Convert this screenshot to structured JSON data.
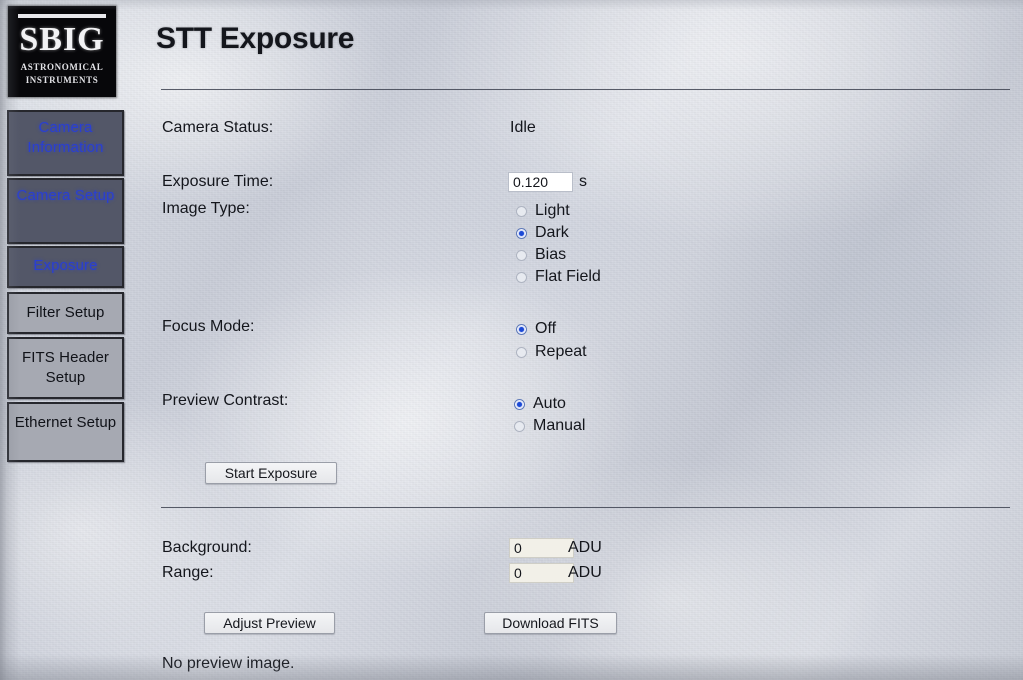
{
  "app": {
    "brand": {
      "name": "SBIG",
      "tagline_line1": "ASTRONOMICAL",
      "tagline_line2": "INSTRUMENTS"
    },
    "page_title": "STT Exposure"
  },
  "sidebar": {
    "items": [
      {
        "label": "Camera Information",
        "style": "link"
      },
      {
        "label": "Camera Setup",
        "style": "link"
      },
      {
        "label": "Exposure",
        "style": "link"
      },
      {
        "label": "Filter Setup",
        "style": "plain"
      },
      {
        "label": "FITS Header Setup",
        "style": "plain"
      },
      {
        "label": "Ethernet Setup",
        "style": "plain"
      }
    ]
  },
  "main": {
    "camera_status": {
      "label": "Camera Status:",
      "value": "Idle"
    },
    "exposure_time": {
      "label": "Exposure Time:",
      "value": "0.120",
      "unit": "s"
    },
    "image_type": {
      "label": "Image Type:",
      "options": [
        "Light",
        "Dark",
        "Bias",
        "Flat Field"
      ],
      "selected": "Dark"
    },
    "focus_mode": {
      "label": "Focus Mode:",
      "options": [
        "Off",
        "Repeat"
      ],
      "selected": "Off"
    },
    "preview_contrast": {
      "label": "Preview Contrast:",
      "options": [
        "Auto",
        "Manual"
      ],
      "selected": "Auto"
    },
    "start_exposure_button": "Start Exposure",
    "background": {
      "label": "Background:",
      "value": "0",
      "unit": "ADU"
    },
    "range": {
      "label": "Range:",
      "value": "0",
      "unit": "ADU"
    },
    "adjust_preview_button": "Adjust Preview",
    "download_fits_button": "Download FITS",
    "preview_status": "No preview image."
  },
  "colors": {
    "link_text": "#2a3fd0",
    "radio_selected": "#1b49d6",
    "nav_link_bg": "#535768",
    "nav_plain_bg": "#a6a9b2",
    "text": "#14161c",
    "screen_bg": "#cfd3dc"
  }
}
